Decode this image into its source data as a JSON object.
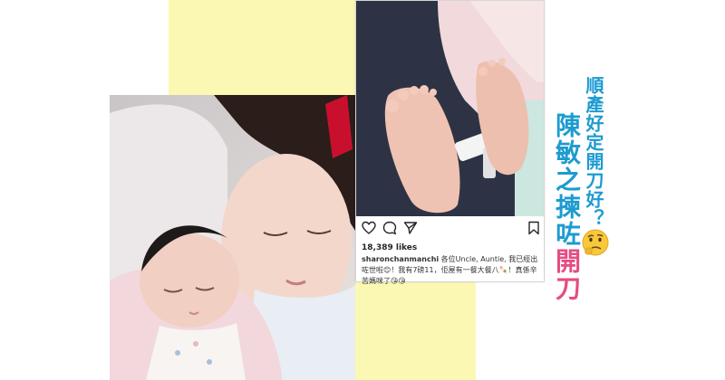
{
  "headline": {
    "question": "順產好定開刀好？",
    "title_part1": "陳敏之揀咗",
    "title_part2": "開刀"
  },
  "instagram": {
    "likes": "18,389 likes",
    "username": "sharonchanmanchi",
    "caption": "各位Uncle, Auntie, 我已經出咗世啦😊！我有7磅11，佢屋有一餐大餐八🍡！真係辛苦媽咪了😘😘",
    "icons": [
      "heart-icon",
      "comment-icon",
      "share-icon",
      "bookmark-icon"
    ]
  },
  "colors": {
    "accent_blue": "#1d9bd0",
    "accent_pink": "#e64c82",
    "background_yellow": "#fbf8b3"
  }
}
